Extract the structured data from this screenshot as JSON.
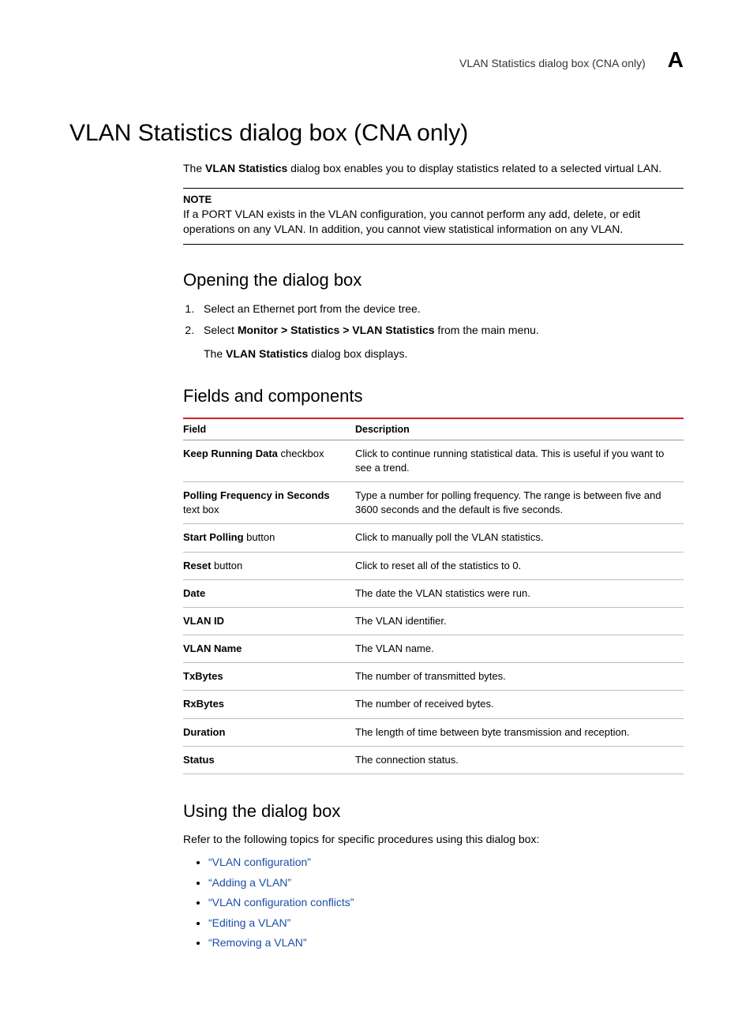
{
  "header": {
    "running_title": "VLAN Statistics dialog box (CNA only)",
    "appendix": "A"
  },
  "title": "VLAN Statistics dialog box (CNA only)",
  "intro": {
    "prefix": "The ",
    "bold": "VLAN Statistics",
    "suffix": " dialog box enables you to display statistics related to a selected virtual LAN."
  },
  "note": {
    "label": "NOTE",
    "body": "If a PORT VLAN exists in the VLAN configuration, you cannot perform any add, delete, or edit operations on any VLAN. In addition, you cannot view statistical information on any VLAN."
  },
  "opening": {
    "heading": "Opening the dialog box",
    "step1": "Select an Ethernet port from the device tree.",
    "step2_prefix": "Select ",
    "step2_bold": "Monitor > Statistics > VLAN Statistics",
    "step2_suffix": " from the main menu.",
    "step2_sub_prefix": "The ",
    "step2_sub_bold": "VLAN Statistics",
    "step2_sub_suffix": " dialog box displays."
  },
  "fields": {
    "heading": "Fields and components",
    "col_field": "Field",
    "col_desc": "Description",
    "rows": [
      {
        "bold": "Keep Running Data",
        "plain": " checkbox",
        "desc": "Click to continue running statistical data. This is useful if you want to see a trend."
      },
      {
        "bold": "Polling Frequency in Seconds",
        "plain": " text box",
        "desc": "Type a number for polling frequency. The range is between five and 3600 seconds and the default is five seconds."
      },
      {
        "bold": "Start Polling",
        "plain": " button",
        "desc": "Click to manually poll the VLAN statistics."
      },
      {
        "bold": "Reset",
        "plain": " button",
        "desc": "Click to reset all of the statistics to 0."
      },
      {
        "bold": "Date",
        "plain": "",
        "desc": "The date the VLAN statistics were run."
      },
      {
        "bold": "VLAN ID",
        "plain": "",
        "desc": "The VLAN identifier."
      },
      {
        "bold": "VLAN Name",
        "plain": "",
        "desc": "The VLAN name."
      },
      {
        "bold": "TxBytes",
        "plain": "",
        "desc": "The number of transmitted bytes."
      },
      {
        "bold": "RxBytes",
        "plain": "",
        "desc": "The number of received bytes."
      },
      {
        "bold": "Duration",
        "plain": "",
        "desc": "The length of time between byte transmission and reception."
      },
      {
        "bold": "Status",
        "plain": "",
        "desc": "The connection status."
      }
    ]
  },
  "using": {
    "heading": "Using the dialog box",
    "intro": "Refer to the following topics for specific procedures using this dialog box:",
    "links": [
      "“VLAN configuration”",
      "“Adding a VLAN”",
      "“VLAN configuration conflicts”",
      "“Editing a VLAN”",
      "“Removing a VLAN”"
    ]
  }
}
